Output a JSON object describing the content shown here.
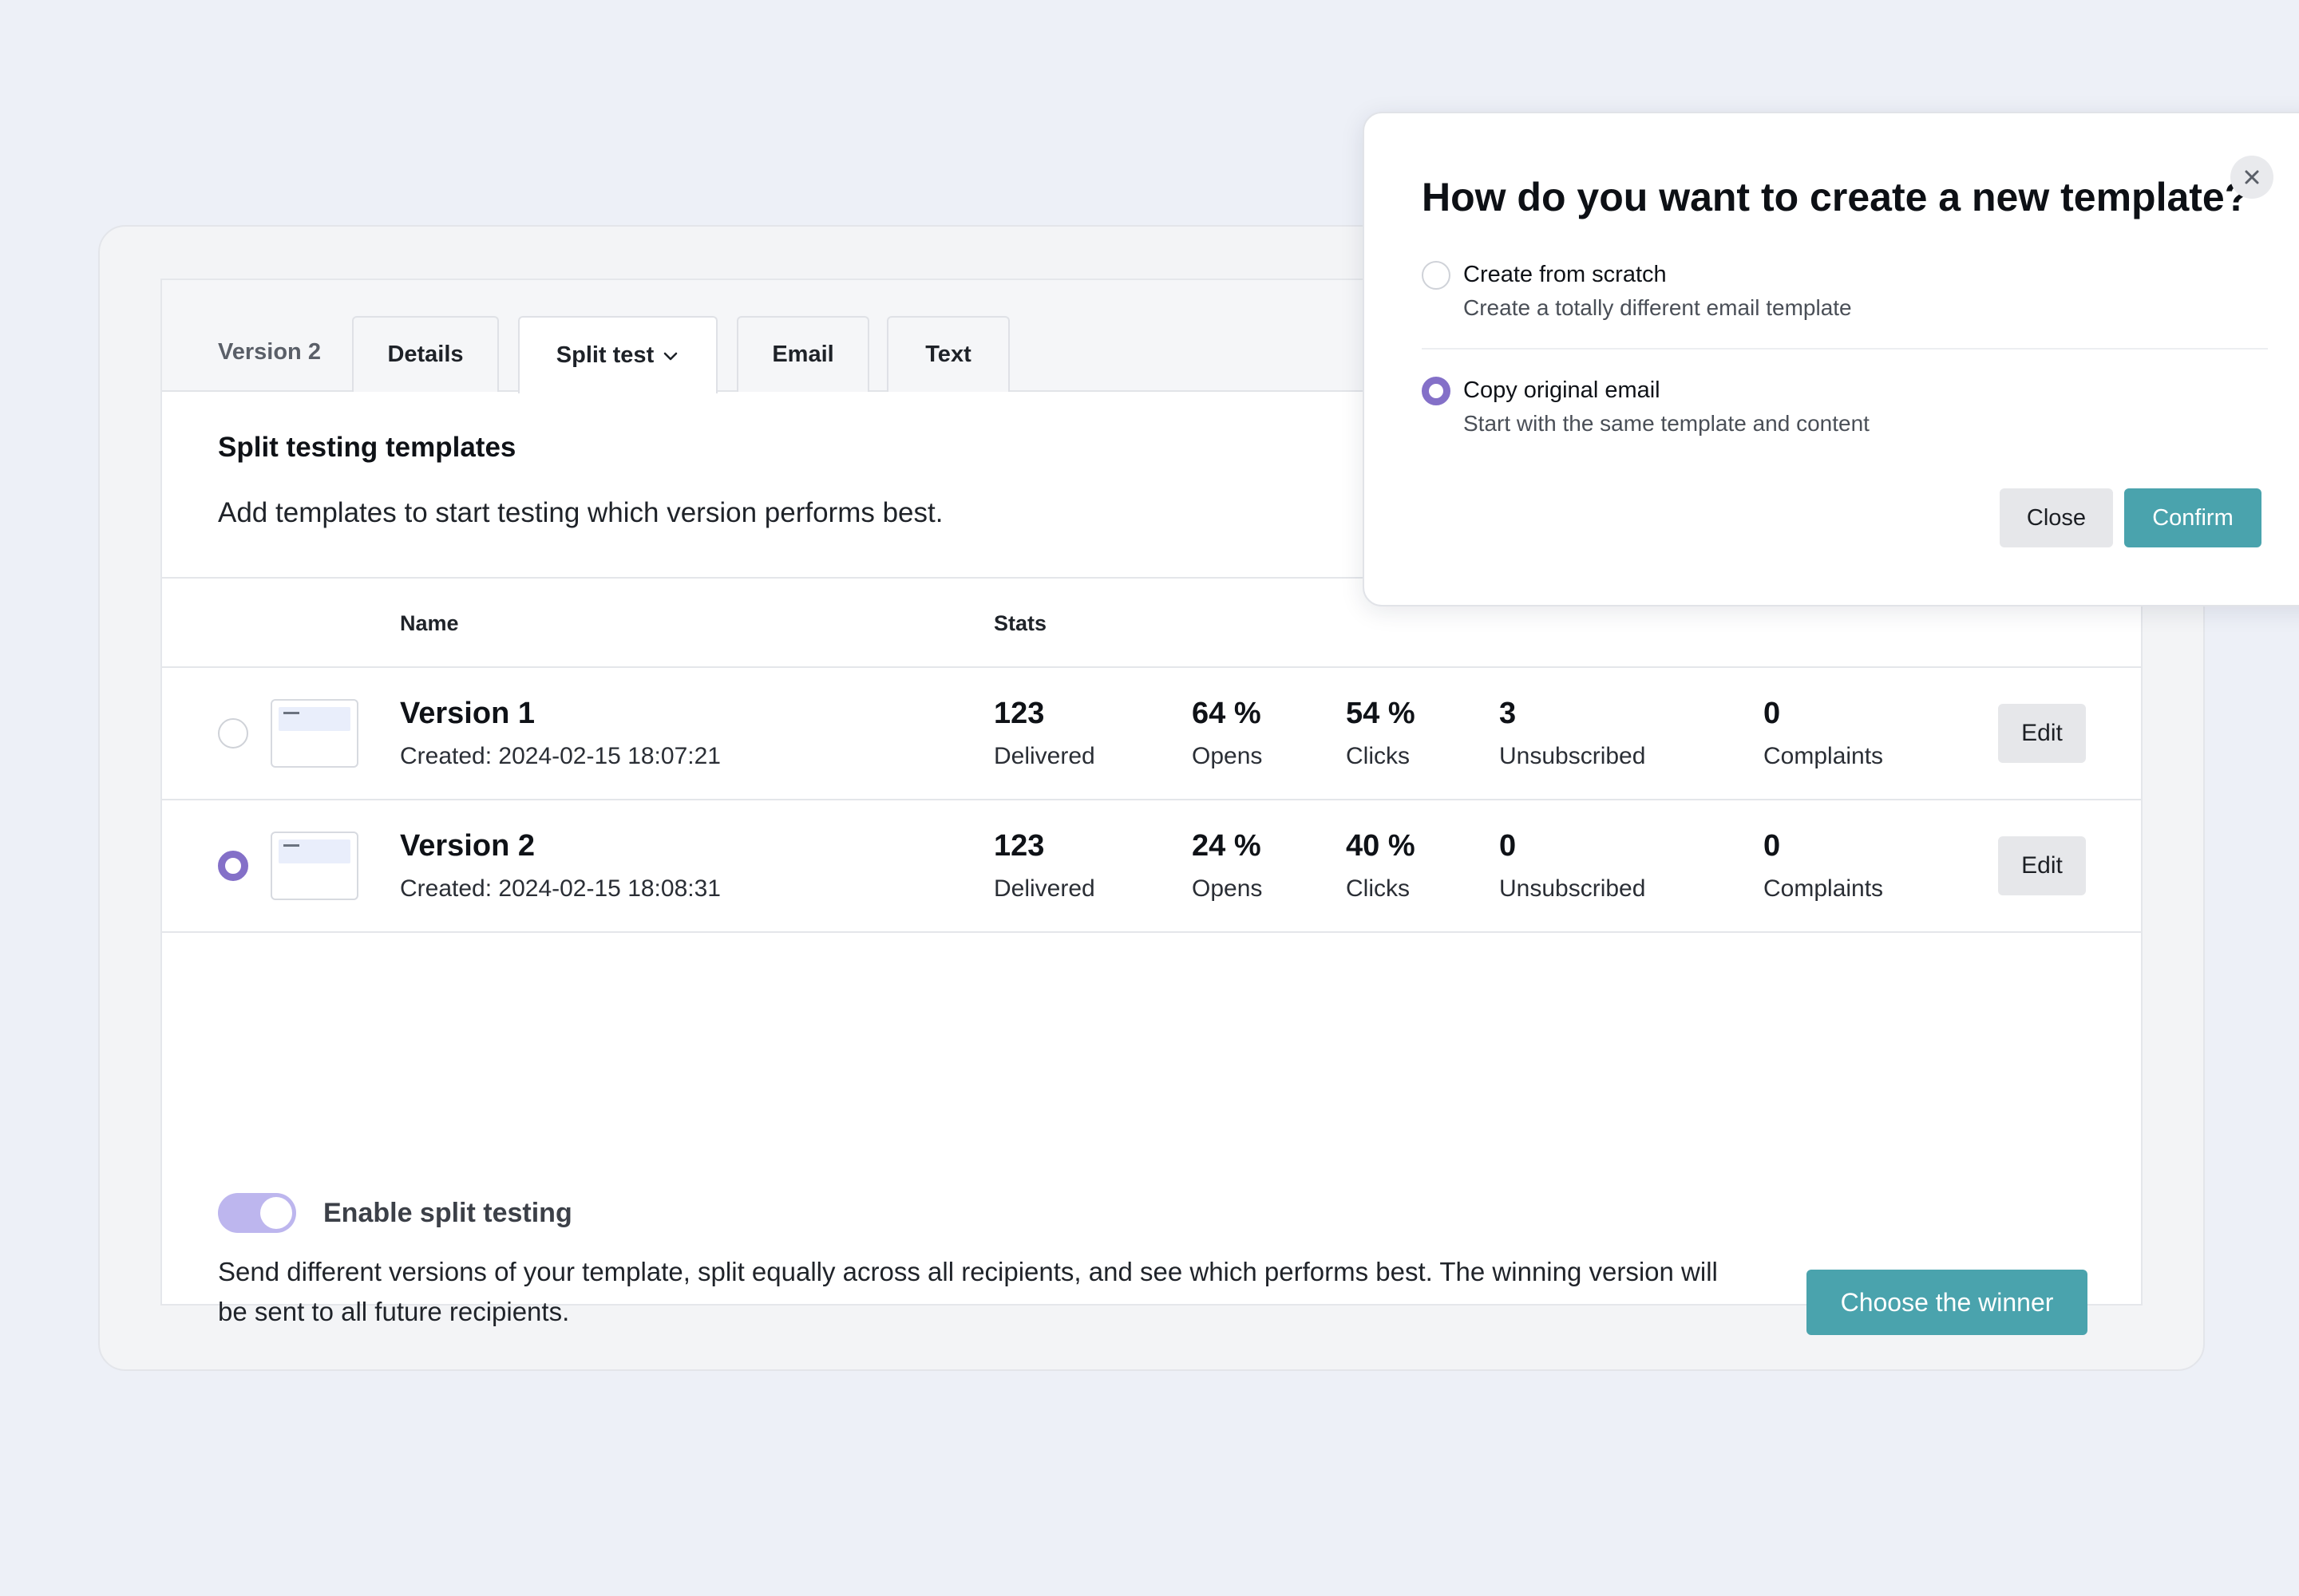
{
  "tabs": {
    "static_label": "Version 2",
    "items": [
      {
        "label": "Details"
      },
      {
        "label": "Split test"
      },
      {
        "label": "Email"
      },
      {
        "label": "Text"
      }
    ],
    "active_index": 1
  },
  "section": {
    "title": "Split testing templates",
    "description": "Add templates to start testing which version performs best."
  },
  "table": {
    "headers": {
      "name": "Name",
      "stats": "Stats"
    },
    "rows": [
      {
        "selected": false,
        "name": "Version 1",
        "created": "Created: 2024-02-15 18:07:21",
        "stats": {
          "delivered": {
            "value": "123",
            "label": "Delivered"
          },
          "opens": {
            "value": "64 %",
            "label": "Opens"
          },
          "clicks": {
            "value": "54 %",
            "label": "Clicks"
          },
          "unsubscribed": {
            "value": "3",
            "label": "Unsubscribed"
          },
          "complaints": {
            "value": "0",
            "label": "Complaints"
          }
        },
        "edit_label": "Edit"
      },
      {
        "selected": true,
        "name": "Version 2",
        "created": "Created: 2024-02-15 18:08:31",
        "stats": {
          "delivered": {
            "value": "123",
            "label": "Delivered"
          },
          "opens": {
            "value": "24 %",
            "label": "Opens"
          },
          "clicks": {
            "value": "40 %",
            "label": "Clicks"
          },
          "unsubscribed": {
            "value": "0",
            "label": "Unsubscribed"
          },
          "complaints": {
            "value": "0",
            "label": "Complaints"
          }
        },
        "edit_label": "Edit"
      }
    ]
  },
  "split_testing": {
    "enabled": true,
    "label": "Enable split testing",
    "description": "Send different versions of your template, split equally across all recipients, and see which performs best. The winning version will be sent to all future recipients.",
    "winner_button": "Choose the winner"
  },
  "modal": {
    "title": "How do you want to create a new template?",
    "options": [
      {
        "title": "Create from scratch",
        "subtitle": "Create a totally different email template",
        "selected": false
      },
      {
        "title": "Copy original email",
        "subtitle": "Start with the same template and content",
        "selected": true
      }
    ],
    "close_label": "Close",
    "confirm_label": "Confirm"
  },
  "colors": {
    "accent_teal": "#4aa3ad",
    "radio_purple": "#8470c8",
    "toggle_track": "#bdb6ee",
    "background": "#edf0f7"
  }
}
